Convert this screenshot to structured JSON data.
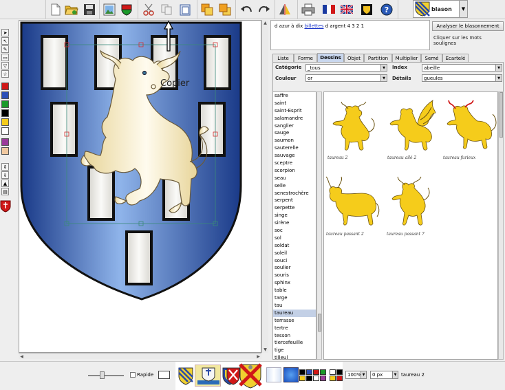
{
  "toolbar": {
    "buttons": [
      {
        "name": "new-icon"
      },
      {
        "name": "open-icon"
      },
      {
        "name": "save-icon"
      },
      {
        "name": "export-image-icon"
      },
      {
        "name": "shield-icon"
      },
      {
        "name": "cut-icon"
      },
      {
        "name": "copy-icon"
      },
      {
        "name": "paste-icon"
      },
      {
        "name": "bring-front-icon"
      },
      {
        "name": "send-back-icon"
      },
      {
        "name": "undo-icon"
      },
      {
        "name": "redo-icon"
      },
      {
        "name": "mirror-icon"
      },
      {
        "name": "print-icon"
      },
      {
        "name": "flag-fr-icon"
      },
      {
        "name": "flag-uk-icon"
      },
      {
        "name": "badge-icon"
      },
      {
        "name": "help-icon"
      }
    ],
    "blason_label": "blason"
  },
  "canvas": {
    "tooltip": "Copier",
    "field_color": "#2c55a0",
    "charge_color": "#f0f0ea"
  },
  "description": {
    "before": "d azur à dix ",
    "link": "billettes",
    "after": " d argent 4 3 2 1"
  },
  "analyse_button": "Analyser le blasonnement",
  "click_hint": "Cliquer sur les mots soulignes",
  "tabs": [
    "Liste",
    "Forme",
    "Dessins",
    "Objet",
    "Partition",
    "Multiplier",
    "Semé",
    "Ecartelé"
  ],
  "active_tab": "Dessins",
  "filters": {
    "categorie_label": "Catégorie",
    "categorie_value": "_tous",
    "index_label": "Index",
    "index_value": "abeille",
    "couleur_label": "Couleur",
    "couleur_value": "or",
    "details_label": "Détails",
    "details_value": "gueules"
  },
  "list": {
    "items": [
      "saffre",
      "saint",
      "saint-Esprit",
      "salamandre",
      "sanglier",
      "sauge",
      "saumon",
      "sauterelle",
      "sauvage",
      "sceptre",
      "scorpion",
      "seau",
      "selle",
      "senestrochère",
      "serpent",
      "serpette",
      "singe",
      "sirène",
      "soc",
      "sol",
      "soldat",
      "soleil",
      "souci",
      "soulier",
      "souris",
      "sphinx",
      "table",
      "targe",
      "tau",
      "taureau",
      "terrasse",
      "tertre",
      "tesson",
      "tiercefeuille",
      "tige",
      "tilleul"
    ],
    "selected": "taureau"
  },
  "gallery": [
    {
      "caption": "taureau 2"
    },
    {
      "caption": "taureau ailé 2"
    },
    {
      "caption": "taureau furieux"
    },
    {
      "caption": "taureau passant 2"
    },
    {
      "caption": "taureau passant 7"
    }
  ],
  "status": {
    "rapide_label": "Rapide",
    "zoom": "100%",
    "offset": "0 px",
    "current": "taureau 2"
  },
  "colors": {
    "azur": "#2b4fb8",
    "or": "#f5cc1b",
    "gueules": "#d01818",
    "argent": "#ffffff",
    "sable": "#000000",
    "sinople": "#1a9a2a",
    "pourpre": "#9a3a9a"
  }
}
